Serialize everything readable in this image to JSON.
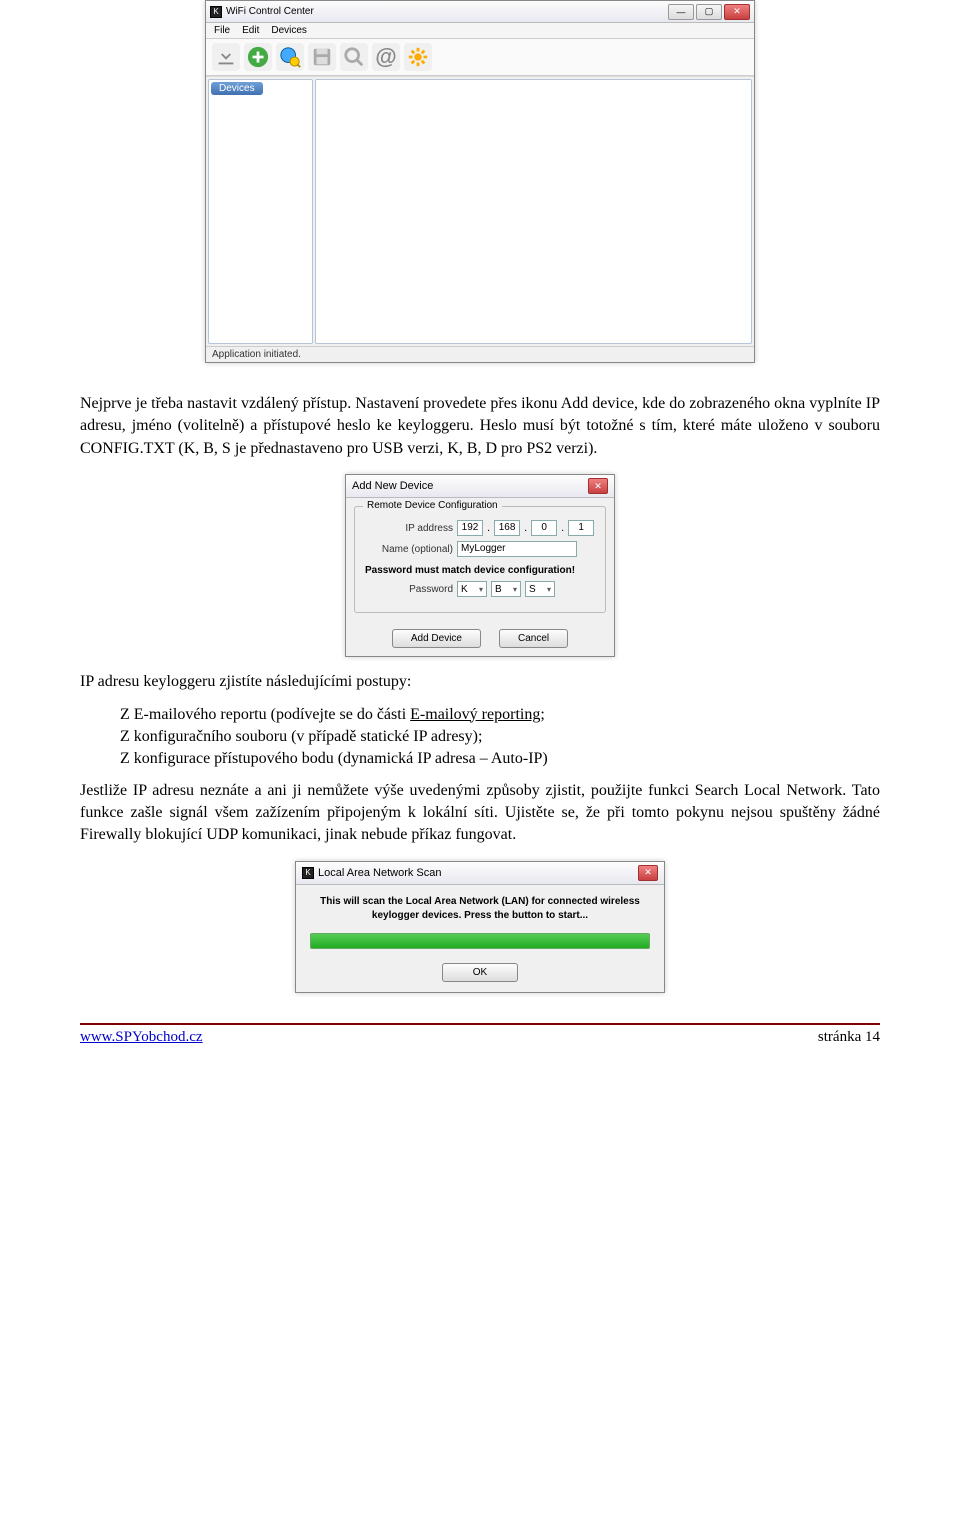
{
  "win": {
    "title": "WiFi Control Center",
    "menu": {
      "file": "File",
      "edit": "Edit",
      "devices": "Devices"
    },
    "side_tab": "Devices",
    "status": "Application initiated."
  },
  "body": {
    "p1": "Nejprve je třeba nastavit vzdálený přístup. Nastavení provedete přes ikonu Add device, kde do zobrazeného okna vyplníte IP adresu, jméno (volitelně) a přístupové heslo ke keyloggeru. Heslo musí být totožné s tím, které máte uloženo v souboru CONFIG.TXT (K, B, S je přednastaveno pro USB verzi, K, B, D pro PS2 verzi).",
    "p2_intro": "IP adresu keyloggeru zjistíte následujícími postupy:",
    "li1_a": "Z E-mailového reportu (podívejte se do části ",
    "li1_link": "E-mailový reporting;",
    "li2": "Z konfiguračního souboru (v případě statické IP adresy);",
    "li3": "Z konfigurace přístupového bodu (dynamická IP adresa – Auto-IP)",
    "p3": "Jestliže IP adresu neznáte a ani ji nemůžete výše uvedenými způsoby zjistit, použijte funkci Search Local Network. Tato funkce zašle signál všem zažízením připojeným k lokální síti. Ujistěte se, že při tomto pokynu nejsou spuštěny žádné Firewally blokující UDP komunikaci, jinak nebude příkaz fungovat."
  },
  "dlg_add": {
    "title": "Add New Device",
    "group": "Remote Device Configuration",
    "lbl_ip": "IP address",
    "ip": [
      "192",
      "168",
      "0",
      "1"
    ],
    "lbl_name": "Name (optional)",
    "name_val": "MyLogger",
    "warn": "Password must match device configuration!",
    "lbl_pass": "Password",
    "pass": [
      "K",
      "B",
      "S"
    ],
    "btn_add": "Add Device",
    "btn_cancel": "Cancel"
  },
  "dlg_lan": {
    "title": "Local Area Network Scan",
    "msg": "This will scan the Local Area Network (LAN) for connected wireless keylogger devices. Press the button to start...",
    "btn_ok": "OK"
  },
  "footer": {
    "url": "www.SPYobchod.cz",
    "page": "stránka 14"
  }
}
